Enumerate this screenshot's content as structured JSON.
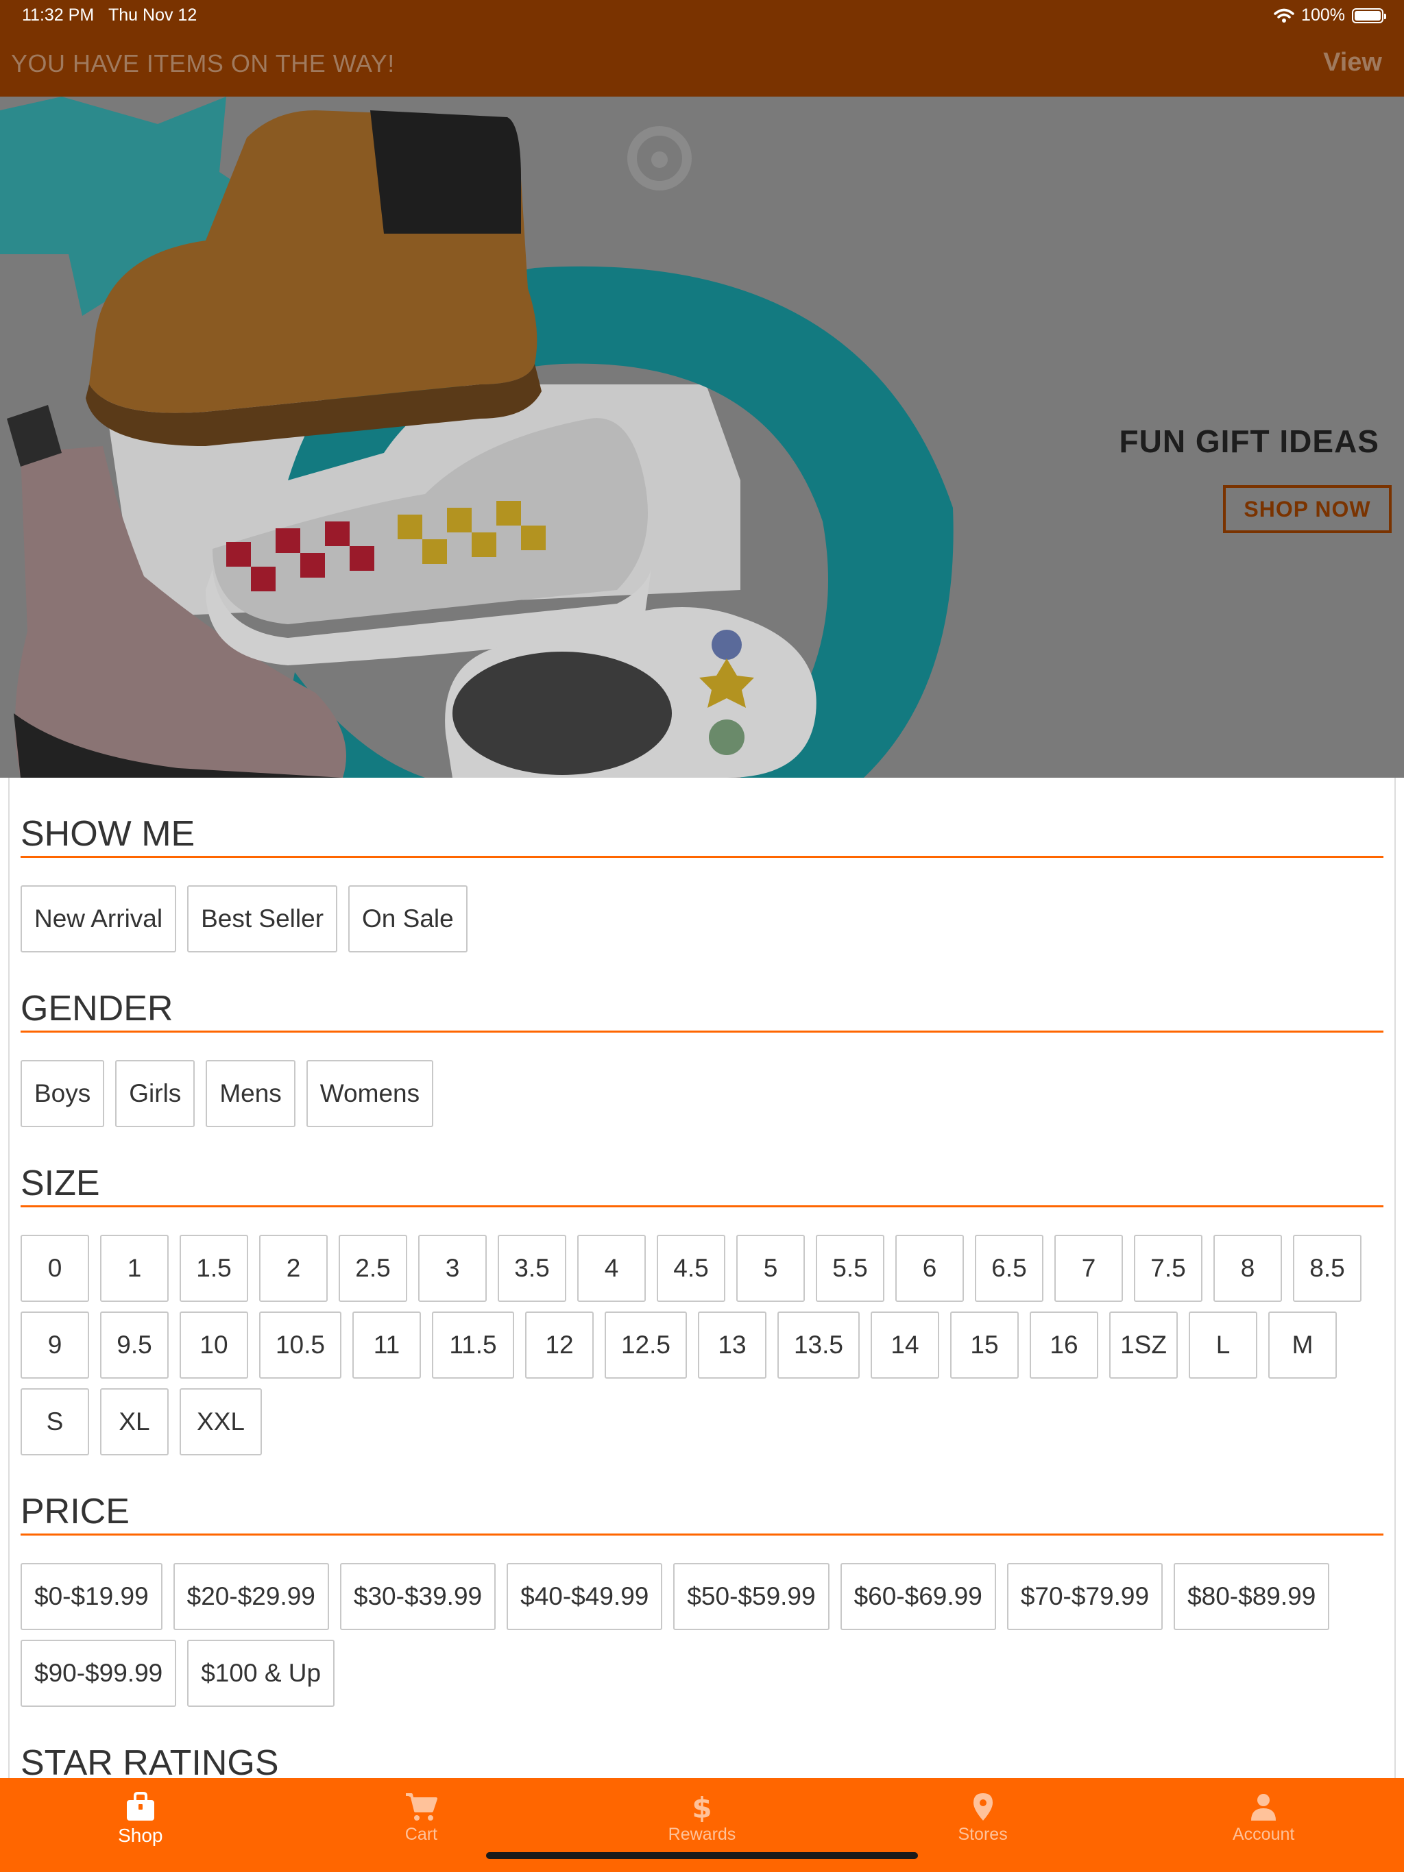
{
  "status_bar": {
    "time": "11:32 PM",
    "date": "Thu Nov 12",
    "battery": "100%"
  },
  "notice": {
    "text": "YOU HAVE ITEMS ON THE WAY!",
    "action": "View"
  },
  "hero": {
    "title": "FUN GIFT IDEAS",
    "cta": "SHOP NOW"
  },
  "filters": {
    "show_me": {
      "title": "SHOW ME",
      "options": [
        "New Arrival",
        "Best Seller",
        "On Sale"
      ]
    },
    "gender": {
      "title": "GENDER",
      "options": [
        "Boys",
        "Girls",
        "Mens",
        "Womens"
      ]
    },
    "size": {
      "title": "SIZE",
      "options": [
        "0",
        "1",
        "1.5",
        "2",
        "2.5",
        "3",
        "3.5",
        "4",
        "4.5",
        "5",
        "5.5",
        "6",
        "6.5",
        "7",
        "7.5",
        "8",
        "8.5",
        "9",
        "9.5",
        "10",
        "10.5",
        "11",
        "11.5",
        "12",
        "12.5",
        "13",
        "13.5",
        "14",
        "15",
        "16",
        "1SZ",
        "L",
        "M",
        "S",
        "XL",
        "XXL"
      ]
    },
    "price": {
      "title": "PRICE",
      "options": [
        "$0-$19.99",
        "$20-$29.99",
        "$30-$39.99",
        "$40-$49.99",
        "$50-$59.99",
        "$60-$69.99",
        "$70-$79.99",
        "$80-$89.99",
        "$90-$99.99",
        "$100 & Up"
      ]
    },
    "star_ratings": {
      "title": "STAR RATINGS"
    }
  },
  "tabs": [
    {
      "label": "Shop",
      "icon": "shopping-bag-icon",
      "active": true
    },
    {
      "label": "Cart",
      "icon": "cart-icon",
      "active": false
    },
    {
      "label": "Rewards",
      "icon": "dollar-icon",
      "active": false
    },
    {
      "label": "Stores",
      "icon": "location-pin-icon",
      "active": false
    },
    {
      "label": "Account",
      "icon": "person-icon",
      "active": false
    }
  ],
  "colors": {
    "header": "#7a3300",
    "accent": "#ff6600",
    "tab_inactive": "#ffc29a"
  }
}
